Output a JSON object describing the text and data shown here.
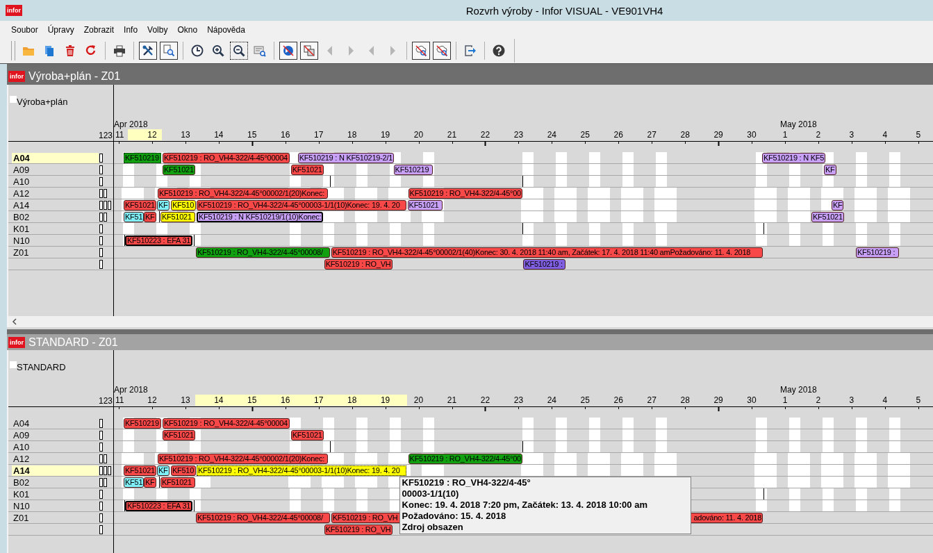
{
  "window": {
    "logo_text": "infor",
    "title": "Rozvrh výroby - Infor VISUAL - VE901VH4"
  },
  "menu": [
    {
      "label": "Soubor"
    },
    {
      "label": "Úpravy"
    },
    {
      "label": "Zobrazit"
    },
    {
      "label": "Info"
    },
    {
      "label": "Volby"
    },
    {
      "label": "Okno"
    },
    {
      "label": "Nápověda"
    }
  ],
  "toolbar": {
    "groups": [
      {
        "items": [
          {
            "kind": "folder",
            "pressed": false,
            "focused": false,
            "disabled": false
          },
          {
            "kind": "documents",
            "pressed": false,
            "focused": false,
            "disabled": false
          },
          {
            "kind": "trash",
            "pressed": false,
            "focused": false,
            "disabled": false
          },
          {
            "kind": "redo",
            "pressed": false,
            "focused": false,
            "disabled": false
          }
        ]
      },
      {
        "items": [
          {
            "kind": "printer",
            "pressed": false,
            "focused": false,
            "disabled": false
          }
        ]
      },
      {
        "items": [
          {
            "kind": "tools",
            "pressed": true,
            "focused": false,
            "disabled": false
          },
          {
            "kind": "find",
            "pressed": true,
            "focused": false,
            "disabled": false
          }
        ]
      },
      {
        "items": [
          {
            "kind": "clock",
            "pressed": false,
            "focused": false,
            "disabled": false
          },
          {
            "kind": "zoomin",
            "pressed": false,
            "focused": false,
            "disabled": false
          },
          {
            "kind": "zoomout",
            "pressed": false,
            "focused": true,
            "disabled": false
          },
          {
            "kind": "docsearch",
            "pressed": false,
            "focused": false,
            "disabled": false
          }
        ]
      },
      {
        "items": [
          {
            "kind": "nocircle",
            "pressed": true,
            "focused": false,
            "disabled": false
          },
          {
            "kind": "nocopy",
            "pressed": true,
            "focused": false,
            "disabled": false
          },
          {
            "kind": "left",
            "pressed": false,
            "focused": false,
            "disabled": true
          },
          {
            "kind": "right",
            "pressed": false,
            "focused": false,
            "disabled": true
          },
          {
            "kind": "left",
            "pressed": false,
            "focused": false,
            "disabled": true
          },
          {
            "kind": "right",
            "pressed": false,
            "focused": false,
            "disabled": true
          }
        ]
      },
      {
        "items": [
          {
            "kind": "nosearch",
            "pressed": true,
            "focused": false,
            "disabled": false
          },
          {
            "kind": "nosearch",
            "pressed": true,
            "focused": false,
            "disabled": false
          }
        ]
      },
      {
        "items": [
          {
            "kind": "exit",
            "pressed": false,
            "focused": false,
            "disabled": false
          }
        ]
      },
      {
        "items": [
          {
            "kind": "help",
            "pressed": false,
            "focused": false,
            "disabled": false
          }
        ]
      }
    ]
  },
  "panels": [
    {
      "logo_text": "infor",
      "title": "Výroba+plán - Z01",
      "active": true,
      "view_label": "Výroba+plán",
      "count_heading": "123",
      "scrollbar": true,
      "months": [
        "Apr 2018",
        "May 2018"
      ],
      "days": [
        "11",
        "12",
        "13",
        "14",
        "15",
        "16",
        "17",
        "18",
        "19",
        "20",
        "21",
        "22",
        "23",
        "24",
        "25",
        "26",
        "27",
        "28",
        "29",
        "30",
        "1",
        "2",
        "3",
        "4",
        "5"
      ],
      "rows": [
        {
          "label": "A04",
          "selected": true,
          "kind": "narrow",
          "slots": [
            {
              "filled": false
            }
          ],
          "bars": [
            {
              "text": "KF510219",
              "color": "#10a010",
              "selected": true,
              "outlined": false
            },
            {
              "text": "KF510219 : RO_VH4-322/4-45°00004",
              "color": "#f84848",
              "selected": false,
              "outlined": false
            },
            {
              "text": "KF510219 : N KF510219-2/1",
              "color": "#c8a0f8",
              "selected": false,
              "outlined": false
            },
            {
              "text": "KF510219 : N KF5",
              "color": "#c8a0f8",
              "selected": false,
              "outlined": false
            }
          ]
        },
        {
          "label": "A09",
          "selected": false,
          "kind": "narrow",
          "slots": [
            {
              "filled": false
            }
          ],
          "bars": [
            {
              "text": "KF51021",
              "color": "#10a010",
              "selected": false,
              "outlined": false
            },
            {
              "text": "KF51021",
              "color": "#f84848",
              "selected": false,
              "outlined": false
            },
            {
              "text": "KF510219",
              "color": "#c8a0f8",
              "selected": false,
              "outlined": false
            },
            {
              "text": "KF",
              "color": "#c8a0f8",
              "selected": false,
              "outlined": false
            }
          ]
        },
        {
          "label": "A10",
          "selected": false,
          "kind": "narrow",
          "slots": [
            {
              "filled": false
            }
          ]
        },
        {
          "label": "A12",
          "selected": false,
          "kind": "wide",
          "slots": [
            {
              "filled": false
            },
            {
              "filled": false
            }
          ],
          "bars": [
            {
              "text": "KF510219 : RO_VH4-322/4-45°00002/1(20)Konec:",
              "color": "#f84848",
              "selected": false,
              "outlined": false
            },
            {
              "text": "KF510219 : RO_VH4-322/4-45°00",
              "color": "#f84848",
              "selected": false,
              "outlined": false
            }
          ]
        },
        {
          "label": "A14",
          "selected": false,
          "kind": "wide",
          "slots": [
            {
              "filled": false
            },
            {
              "filled": false
            },
            {
              "filled": false
            }
          ],
          "bars": [
            {
              "text": "KF51021",
              "color": "#f84848",
              "selected": false,
              "outlined": false
            },
            {
              "text": "KF",
              "color": "#80f0f8",
              "selected": false,
              "outlined": false
            },
            {
              "text": "KF510",
              "color": "#ffff00",
              "selected": false,
              "outlined": false
            },
            {
              "text": "KF510219 : RO_VH4-322/4-45°00003-1/1(10)Konec: 19. 4. 20",
              "color": "#f84848",
              "selected": false,
              "outlined": false
            },
            {
              "text": "KF51021",
              "color": "#c8a0f8",
              "selected": false,
              "outlined": false
            },
            {
              "text": "KF",
              "color": "#c8a0f8",
              "selected": false,
              "outlined": false
            }
          ]
        },
        {
          "label": "B02",
          "selected": false,
          "kind": "wide",
          "slots": [
            {
              "filled": false
            },
            {
              "filled": false
            }
          ],
          "bars": [
            {
              "text": "KF51",
              "color": "#80f0f8",
              "selected": false,
              "outlined": false
            },
            {
              "text": "KF",
              "color": "#f84848",
              "selected": false,
              "outlined": false
            },
            {
              "text": "KF51021",
              "color": "#ffff00",
              "selected": false,
              "outlined": false
            },
            {
              "text": "KF510219 : N KF510219/1(10)Konec:",
              "color": "#c8a0f8",
              "selected": false,
              "outlined": true
            },
            {
              "text": "KF51021",
              "color": "#c8a0f8",
              "selected": false,
              "outlined": false
            }
          ]
        },
        {
          "label": "K01",
          "selected": false,
          "kind": "narrow",
          "slots": [
            {
              "filled": false
            }
          ]
        },
        {
          "label": "N10",
          "selected": false,
          "kind": "narrow",
          "slots": [
            {
              "filled": false
            }
          ],
          "bars": [
            {
              "text": "KF510223 : EFA 31",
              "color": "#f84848",
              "selected": false,
              "outlined": true
            }
          ]
        },
        {
          "label": "Z01",
          "selected": false,
          "kind": "plain",
          "slots": [
            {
              "filled": false
            }
          ],
          "bars": [
            {
              "text": "KF510219 : RO_VH4-322/4-45°00008/",
              "color": "#10a010",
              "selected": false,
              "outlined": false
            },
            {
              "text": "KF510219 : RO_VH4-322/4-45°00002/1(40)Konec: 30. 4. 2018 11:40 am, Začátek: 17. 4. 2018 11:40 amPožadováno: 11. 4. 2018",
              "color": "#f84848",
              "selected": false,
              "outlined": false
            },
            {
              "text": "KF510219 :",
              "color": "#c8a0f8",
              "selected": false,
              "outlined": false
            }
          ]
        },
        {
          "kind": "plain",
          "slots": [
            {
              "filled": false
            }
          ],
          "bars": [
            {
              "text": "KF510219 : RO_VH",
              "color": "#f84848",
              "selected": false,
              "outlined": false
            },
            {
              "text": "KF510219 :",
              "color": "#8060e0",
              "selected": false,
              "outlined": false
            }
          ]
        }
      ]
    },
    {
      "logo_text": "infor",
      "title": "STANDARD - Z01",
      "active": false,
      "view_label": "STANDARD",
      "count_heading": "123",
      "scrollbar": false,
      "months": [
        "Apr 2018",
        "May 2018"
      ],
      "days": [
        "11",
        "12",
        "13",
        "14",
        "15",
        "16",
        "17",
        "18",
        "19",
        "20",
        "21",
        "22",
        "23",
        "24",
        "25",
        "26",
        "27",
        "28",
        "29",
        "30",
        "1",
        "2",
        "3",
        "4",
        "5"
      ],
      "tooltip": {
        "lines": [
          "KF510219 : RO_VH4-322/4-45°",
          "00003-1/1(10)",
          "Konec: 19. 4. 2018 7:20 pm, Začátek: 13. 4. 2018 10:00 am",
          "Požadováno: 15. 4. 2018",
          "Zdroj obsazen"
        ]
      },
      "rows": [
        {
          "label": "A04",
          "selected": false,
          "kind": "narrow",
          "slots": [
            {
              "filled": false
            }
          ],
          "bars": [
            {
              "text": "KF510219",
              "color": "#f84848",
              "selected": false,
              "outlined": false
            },
            {
              "text": "KF510219 : RO_VH4-322/4-45°00004",
              "color": "#f84848",
              "selected": false,
              "outlined": false
            }
          ]
        },
        {
          "label": "A09",
          "selected": false,
          "kind": "narrow",
          "slots": [
            {
              "filled": false
            }
          ],
          "bars": [
            {
              "text": "KF51021",
              "color": "#f84848",
              "selected": false,
              "outlined": false
            },
            {
              "text": "KF51021",
              "color": "#f84848",
              "selected": false,
              "outlined": false
            }
          ]
        },
        {
          "label": "A10",
          "selected": false,
          "kind": "narrow",
          "slots": [
            {
              "filled": false
            }
          ]
        },
        {
          "label": "A12",
          "selected": false,
          "kind": "wide",
          "slots": [
            {
              "filled": false
            },
            {
              "filled": false
            }
          ],
          "bars": [
            {
              "text": "KF510219 : RO_VH4-322/4-45°00002/1(20)Konec:",
              "color": "#f84848",
              "selected": false,
              "outlined": false
            },
            {
              "text": "KF510219 : RO_VH4-322/4-45°00",
              "color": "#10a010",
              "selected": false,
              "outlined": false
            }
          ]
        },
        {
          "label": "A14",
          "selected": true,
          "kind": "wide",
          "slots": [
            {
              "filled": false
            },
            {
              "filled": false
            },
            {
              "filled": false
            }
          ],
          "bars": [
            {
              "text": "KF51021",
              "color": "#f84848",
              "selected": false,
              "outlined": false
            },
            {
              "text": "KF",
              "color": "#80f0f8",
              "selected": false,
              "outlined": false
            },
            {
              "text": "KF510",
              "color": "#f84848",
              "selected": false,
              "outlined": false
            },
            {
              "text": "KF510219 : RO_VH4-322/4-45°00003-1/1(10)Konec: 19. 4. 20",
              "color": "#ffff00",
              "selected": true,
              "outlined": false
            }
          ]
        },
        {
          "label": "B02",
          "selected": false,
          "kind": "wide",
          "slots": [
            {
              "filled": false
            },
            {
              "filled": false
            }
          ],
          "bars": [
            {
              "text": "KF51",
              "color": "#80f0f8",
              "selected": false,
              "outlined": false
            },
            {
              "text": "KF",
              "color": "#f84848",
              "selected": false,
              "outlined": false
            },
            {
              "text": "KF51021",
              "color": "#f84848",
              "selected": false,
              "outlined": false
            }
          ]
        },
        {
          "label": "K01",
          "selected": false,
          "kind": "narrow",
          "slots": [
            {
              "filled": false
            }
          ]
        },
        {
          "label": "N10",
          "selected": false,
          "kind": "narrow",
          "slots": [
            {
              "filled": false
            }
          ],
          "bars": [
            {
              "text": "KF510223 : EFA 31",
              "color": "#f84848",
              "selected": false,
              "outlined": true
            }
          ]
        },
        {
          "label": "Z01",
          "selected": false,
          "kind": "plain",
          "slots": [
            {
              "filled": false
            }
          ],
          "bars": [
            {
              "text": "KF510219 : RO_VH4-322/4-45°00008/",
              "color": "#f84848",
              "selected": false,
              "outlined": false
            },
            {
              "text": "KF510219 : RO_VH",
              "text_end": "adováno: 11. 4. 2018",
              "color": "#f84848",
              "selected": false,
              "outlined": false
            }
          ]
        },
        {
          "kind": "plain",
          "slots": [
            {
              "filled": false
            }
          ],
          "bars": [
            {
              "text": "KF510219 : RO_VH",
              "color": "#f84848",
              "selected": false,
              "outlined": false
            }
          ]
        }
      ]
    }
  ]
}
